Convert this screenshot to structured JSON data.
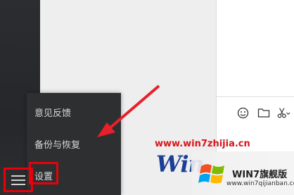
{
  "menu": {
    "items": [
      {
        "label": "意见反馈"
      },
      {
        "label": "备份与恢复"
      },
      {
        "label": "设置"
      }
    ]
  },
  "watermark": {
    "url": "www.win7zhijia.cn",
    "logo_text": "Win",
    "badge_title": "WIN7旗舰版",
    "badge_url": "www.win7qijianban.com"
  },
  "toolbar": {
    "icons": [
      "emoji-icon",
      "folder-icon",
      "scissors-icon"
    ]
  },
  "colors": {
    "sidebar": "#2b2d30",
    "menu_bg": "#2e2f31",
    "highlight": "#e8000b",
    "arrow": "#e8202a",
    "watermark_red": "#d9141b",
    "logo_blue": "#1c3f96"
  }
}
